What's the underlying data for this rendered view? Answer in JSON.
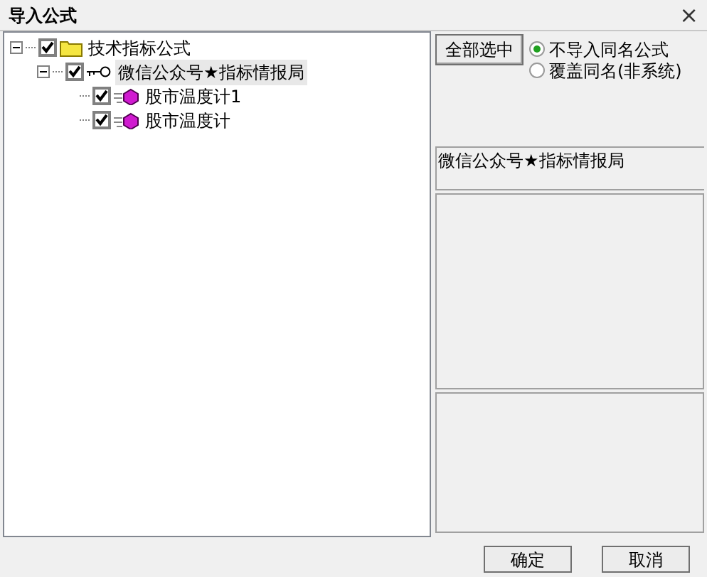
{
  "window": {
    "title": "导入公式",
    "close": "×"
  },
  "tree": [
    {
      "label": "技术指标公式",
      "kind": "folder",
      "checked": true,
      "expanded": true,
      "selected": false,
      "children": [
        {
          "label": "微信公众号★指标情报局",
          "kind": "group",
          "checked": true,
          "expanded": true,
          "selected": true,
          "children": [
            {
              "label": "股市温度计1",
              "kind": "formula",
              "checked": true,
              "selected": false
            },
            {
              "label": "股市温度计",
              "kind": "formula",
              "checked": true,
              "selected": false
            }
          ]
        }
      ]
    }
  ],
  "select_all_button": "全部选中",
  "options": [
    {
      "label": "不导入同名公式",
      "selected": true
    },
    {
      "label": "覆盖同名(非系统)",
      "selected": false
    }
  ],
  "info_text": "微信公众号★指标情报局",
  "buttons": [
    "确定",
    "取消"
  ]
}
